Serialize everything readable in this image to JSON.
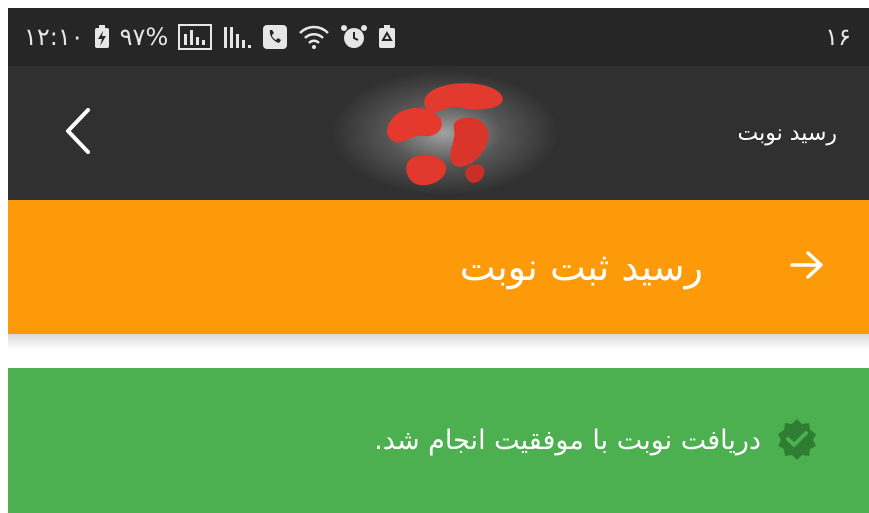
{
  "status_bar": {
    "time": "۱۲:۱۰",
    "battery": "۹۷%",
    "notification_count": "۱۶"
  },
  "app_bar": {
    "title": "رسید نوبت"
  },
  "header": {
    "title": "رسید ثبت نوبت"
  },
  "message": {
    "text": "دریافت نوبت با موفقیت انجام شد."
  },
  "colors": {
    "status_bar": "#262626",
    "app_bar": "#303030",
    "header": "#fc9a0a",
    "success": "#4caf50",
    "success_icon": "#2e7d32"
  },
  "icons": {
    "back": "chevron-left-icon",
    "forward": "arrow-right-icon",
    "success": "verified-check-icon"
  }
}
